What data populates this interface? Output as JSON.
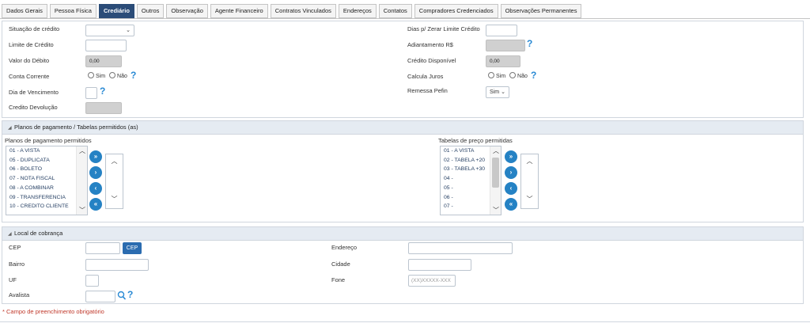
{
  "tabs": [
    "Dados Gerais",
    "Pessoa Física",
    "Crediário",
    "Outros",
    "Observação",
    "Agente Financeiro",
    "Contratos Vinculados",
    "Endereços",
    "Contatos",
    "Compradores Credenciados",
    "Observações Permanentes"
  ],
  "active_tab": "Crediário",
  "credito": {
    "situacao_label": "Situação de crédito",
    "limite_label": "Limite de Crédito",
    "valor_debito_label": "Valor do Débito",
    "valor_debito_value": "0,00",
    "conta_corrente_label": "Conta Corrente",
    "sim_label": "Sim",
    "nao_label": "Não",
    "dia_vencimento_label": "Dia de Vencimento",
    "credito_devolucao_label": "Credito Devolução",
    "dias_zerar_label": "Dias p/ Zerar Limite Crédito",
    "adiantamento_label": "Adiantamento R$",
    "credito_disponivel_label": "Crédito Disponível",
    "credito_disponivel_value": "0,00",
    "calcula_juros_label": "Calcula Juros",
    "remessa_pefin_label": "Remessa Pefin",
    "remessa_pefin_value": "Sim"
  },
  "planos_panel": {
    "title": "Planos de pagamento / Tabelas permitidos (as)",
    "planos_label": "Planos de pagamento permitidos",
    "planos_items": [
      "01 - A VISTA",
      "05 - DUPLICATA",
      "06 - BOLETO",
      "07 - NOTA FISCAL",
      "08 - A COMBINAR",
      "09 - TRANSFERENCIA",
      "10 - CREDITO CLIENTE"
    ],
    "tabelas_label": "Tabelas de preço permitidas",
    "tabelas_items": [
      "01 - A VISTA",
      "02 - TABELA +20",
      "03 - TABELA +30",
      "04 -",
      "05 -",
      "06 -",
      "07 -"
    ]
  },
  "cobranca_panel": {
    "title": "Local de cobrança",
    "cep_label": "CEP",
    "cep_button": "CEP",
    "bairro_label": "Bairro",
    "uf_label": "UF",
    "avalista_label": "Avalista",
    "endereco_label": "Endereço",
    "cidade_label": "Cidade",
    "fone_label": "Fone",
    "fone_placeholder": "(XX)XXXXX-XXX"
  },
  "required_note": "* Campo de preenchimento obrigatório",
  "icons": {
    "help": "question-mark",
    "move_all_right": "double-chevron-right",
    "move_right": "chevron-right",
    "move_left": "chevron-left",
    "move_all_left": "double-chevron-left",
    "search": "magnifier"
  },
  "colors": {
    "accent": "#2b4c78",
    "button_blue": "#2582c4",
    "help_blue": "#2a8ad4",
    "required_red": "#c0392b"
  }
}
